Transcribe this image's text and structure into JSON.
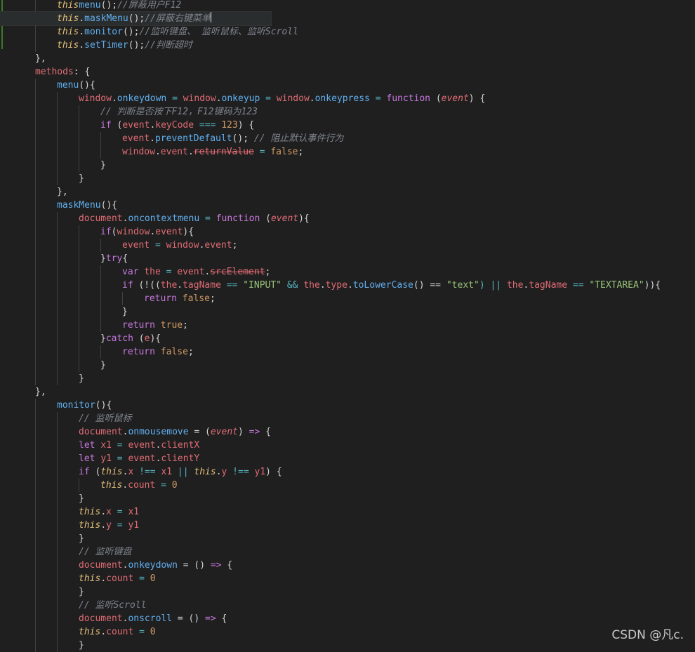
{
  "editor": {
    "lines": [
      {
        "indent": 2,
        "tokens": [
          [
            "this",
            "this"
          ],
          [
            "menu",
            "fn"
          ],
          [
            "();",
            "pun"
          ],
          [
            "//屏蔽用户F12",
            "cm"
          ]
        ]
      },
      {
        "indent": 2,
        "active": true,
        "tokens": [
          [
            "this",
            "this"
          ],
          [
            ".",
            "pun"
          ],
          [
            "maskMenu",
            "fn"
          ],
          [
            "();",
            "pun"
          ],
          [
            "//屏蔽右键菜单",
            "cm"
          ]
        ]
      },
      {
        "indent": 2,
        "tokens": [
          [
            "this",
            "this"
          ],
          [
            ".",
            "pun"
          ],
          [
            "monitor",
            "fn"
          ],
          [
            "();",
            "pun"
          ],
          [
            "//监听键盘、 监听鼠标、监听Scroll",
            "cm"
          ]
        ]
      },
      {
        "indent": 2,
        "tokens": [
          [
            "this",
            "this"
          ],
          [
            ".",
            "pun"
          ],
          [
            "setTimer",
            "fn"
          ],
          [
            "();",
            "pun"
          ],
          [
            "//判断超时",
            "cm"
          ]
        ]
      },
      {
        "indent": 1,
        "tokens": [
          [
            "},",
            "pun"
          ]
        ]
      },
      {
        "indent": 1,
        "tokens": [
          [
            "methods",
            "var"
          ],
          [
            ": {",
            "pun"
          ]
        ]
      },
      {
        "indent": 2,
        "tokens": [
          [
            "menu",
            "fn"
          ],
          [
            "(){",
            "pun"
          ]
        ]
      },
      {
        "indent": 3,
        "tokens": [
          [
            "window",
            "var"
          ],
          [
            ".",
            "pun"
          ],
          [
            "onkeydown",
            "prop"
          ],
          [
            " = ",
            "op"
          ],
          [
            "window",
            "var"
          ],
          [
            ".",
            "pun"
          ],
          [
            "onkeyup",
            "prop"
          ],
          [
            " = ",
            "op"
          ],
          [
            "window",
            "var"
          ],
          [
            ".",
            "pun"
          ],
          [
            "onkeypress",
            "prop"
          ],
          [
            " = ",
            "op"
          ],
          [
            "function",
            "kw"
          ],
          [
            " (",
            "pun"
          ],
          [
            "event",
            "param"
          ],
          [
            ") {",
            "pun"
          ]
        ]
      },
      {
        "indent": 4,
        "tokens": [
          [
            "// 判断是否按下F12，F12键码为123",
            "cm"
          ]
        ]
      },
      {
        "indent": 4,
        "tokens": [
          [
            "if",
            "kw"
          ],
          [
            " (",
            "pun"
          ],
          [
            "event",
            "var"
          ],
          [
            ".",
            "pun"
          ],
          [
            "keyCode",
            "var"
          ],
          [
            " === ",
            "op"
          ],
          [
            "123",
            "num"
          ],
          [
            ") {",
            "pun"
          ]
        ]
      },
      {
        "indent": 5,
        "tokens": [
          [
            "event",
            "var"
          ],
          [
            ".",
            "pun"
          ],
          [
            "preventDefault",
            "fn"
          ],
          [
            "(); ",
            "pun"
          ],
          [
            "// 阻止默认事件行为",
            "cm"
          ]
        ]
      },
      {
        "indent": 5,
        "tokens": [
          [
            "window",
            "var"
          ],
          [
            ".",
            "pun"
          ],
          [
            "event",
            "var"
          ],
          [
            ".",
            "pun"
          ],
          [
            "returnValue",
            "strike"
          ],
          [
            " = ",
            "op"
          ],
          [
            "false",
            "num"
          ],
          [
            ";",
            "pun"
          ]
        ]
      },
      {
        "indent": 4,
        "tokens": [
          [
            "}",
            "pun"
          ]
        ]
      },
      {
        "indent": 3,
        "tokens": [
          [
            "}",
            "pun"
          ]
        ]
      },
      {
        "indent": 2,
        "tokens": [
          [
            "},",
            "pun"
          ]
        ]
      },
      {
        "indent": 2,
        "tokens": [
          [
            "maskMenu",
            "fn"
          ],
          [
            "(){",
            "pun"
          ]
        ]
      },
      {
        "indent": 3,
        "tokens": [
          [
            "document",
            "var"
          ],
          [
            ".",
            "pun"
          ],
          [
            "oncontextmenu",
            "prop"
          ],
          [
            " = ",
            "op"
          ],
          [
            "function",
            "kw"
          ],
          [
            " (",
            "pun"
          ],
          [
            "event",
            "param"
          ],
          [
            "){",
            "pun"
          ]
        ]
      },
      {
        "indent": 4,
        "tokens": [
          [
            "if",
            "kw"
          ],
          [
            "(",
            "pun"
          ],
          [
            "window",
            "var"
          ],
          [
            ".",
            "pun"
          ],
          [
            "event",
            "var"
          ],
          [
            "){",
            "pun"
          ]
        ]
      },
      {
        "indent": 5,
        "tokens": [
          [
            "event",
            "var"
          ],
          [
            " = ",
            "op"
          ],
          [
            "window",
            "var"
          ],
          [
            ".",
            "pun"
          ],
          [
            "event",
            "var"
          ],
          [
            ";",
            "pun"
          ]
        ]
      },
      {
        "indent": 4,
        "tokens": [
          [
            "}",
            "pun"
          ],
          [
            "try",
            "kw"
          ],
          [
            "{",
            "pun"
          ]
        ]
      },
      {
        "indent": 5,
        "tokens": [
          [
            "var",
            "kw"
          ],
          [
            " ",
            "pun"
          ],
          [
            "the",
            "var"
          ],
          [
            " = ",
            "op"
          ],
          [
            "event",
            "var"
          ],
          [
            ".",
            "pun"
          ],
          [
            "srcElement",
            "strike"
          ],
          [
            ";",
            "pun"
          ]
        ]
      },
      {
        "indent": 5,
        "tokens": [
          [
            "if",
            "kw"
          ],
          [
            " (!((",
            "pun"
          ],
          [
            "the",
            "var"
          ],
          [
            ".",
            "pun"
          ],
          [
            "tagName",
            "var"
          ],
          [
            " == ",
            "op"
          ],
          [
            "\"INPUT\"",
            "str"
          ],
          [
            " && ",
            "op"
          ],
          [
            "the",
            "var"
          ],
          [
            ".",
            "pun"
          ],
          [
            "type",
            "var"
          ],
          [
            ".",
            "pun"
          ],
          [
            "toLowerCase",
            "fn"
          ],
          [
            "() == ",
            "pun"
          ],
          [
            "\"text\"",
            "str"
          ],
          [
            ") || ",
            "op"
          ],
          [
            "the",
            "var"
          ],
          [
            ".",
            "pun"
          ],
          [
            "tagName",
            "var"
          ],
          [
            " == ",
            "op"
          ],
          [
            "\"TEXTAREA\"",
            "str"
          ],
          [
            ")){",
            "pun"
          ]
        ]
      },
      {
        "indent": 6,
        "tokens": [
          [
            "return",
            "kw"
          ],
          [
            " ",
            "pun"
          ],
          [
            "false",
            "num"
          ],
          [
            ";",
            "pun"
          ]
        ]
      },
      {
        "indent": 5,
        "tokens": [
          [
            "}",
            "pun"
          ]
        ]
      },
      {
        "indent": 5,
        "tokens": [
          [
            "return",
            "kw"
          ],
          [
            " ",
            "pun"
          ],
          [
            "true",
            "num"
          ],
          [
            ";",
            "pun"
          ]
        ]
      },
      {
        "indent": 4,
        "tokens": [
          [
            "}",
            "pun"
          ],
          [
            "catch",
            "kw"
          ],
          [
            " (",
            "pun"
          ],
          [
            "e",
            "var"
          ],
          [
            "){",
            "pun"
          ]
        ]
      },
      {
        "indent": 5,
        "tokens": [
          [
            "return",
            "kw"
          ],
          [
            " ",
            "pun"
          ],
          [
            "false",
            "num"
          ],
          [
            ";",
            "pun"
          ]
        ]
      },
      {
        "indent": 4,
        "tokens": [
          [
            "}",
            "pun"
          ]
        ]
      },
      {
        "indent": 3,
        "tokens": [
          [
            "}",
            "pun"
          ]
        ]
      },
      {
        "indent": 1,
        "tokens": [
          [
            "},",
            "pun"
          ]
        ]
      },
      {
        "indent": 2,
        "tokens": [
          [
            "monitor",
            "fn"
          ],
          [
            "(){",
            "pun"
          ]
        ]
      },
      {
        "indent": 3,
        "tokens": [
          [
            "// 监听鼠标",
            "cm"
          ]
        ]
      },
      {
        "indent": 3,
        "tokens": [
          [
            "document",
            "var"
          ],
          [
            ".",
            "pun"
          ],
          [
            "onmousemove",
            "prop"
          ],
          [
            " = (",
            "pun"
          ],
          [
            "event",
            "param"
          ],
          [
            ") ",
            "pun"
          ],
          [
            "=>",
            "kw"
          ],
          [
            " {",
            "pun"
          ]
        ]
      },
      {
        "indent": 3,
        "tokens": [
          [
            "let",
            "kw"
          ],
          [
            " ",
            "pun"
          ],
          [
            "x1",
            "var"
          ],
          [
            " = ",
            "op"
          ],
          [
            "event",
            "var"
          ],
          [
            ".",
            "pun"
          ],
          [
            "clientX",
            "var"
          ]
        ]
      },
      {
        "indent": 3,
        "tokens": [
          [
            "let",
            "kw"
          ],
          [
            " ",
            "pun"
          ],
          [
            "y1",
            "var"
          ],
          [
            " = ",
            "op"
          ],
          [
            "event",
            "var"
          ],
          [
            ".",
            "pun"
          ],
          [
            "clientY",
            "var"
          ]
        ]
      },
      {
        "indent": 3,
        "tokens": [
          [
            "if",
            "kw"
          ],
          [
            " (",
            "pun"
          ],
          [
            "this",
            "this"
          ],
          [
            ".",
            "pun"
          ],
          [
            "x",
            "var"
          ],
          [
            " !== ",
            "op"
          ],
          [
            "x1",
            "var"
          ],
          [
            " || ",
            "op"
          ],
          [
            "this",
            "this"
          ],
          [
            ".",
            "pun"
          ],
          [
            "y",
            "var"
          ],
          [
            " !== ",
            "op"
          ],
          [
            "y1",
            "var"
          ],
          [
            ") {",
            "pun"
          ]
        ]
      },
      {
        "indent": 4,
        "tokens": [
          [
            "this",
            "this"
          ],
          [
            ".",
            "pun"
          ],
          [
            "count",
            "var"
          ],
          [
            " = ",
            "op"
          ],
          [
            "0",
            "num"
          ]
        ]
      },
      {
        "indent": 3,
        "tokens": [
          [
            "}",
            "pun"
          ]
        ]
      },
      {
        "indent": 3,
        "tokens": [
          [
            "this",
            "this"
          ],
          [
            ".",
            "pun"
          ],
          [
            "x",
            "var"
          ],
          [
            " = ",
            "op"
          ],
          [
            "x1",
            "var"
          ]
        ]
      },
      {
        "indent": 3,
        "tokens": [
          [
            "this",
            "this"
          ],
          [
            ".",
            "pun"
          ],
          [
            "y",
            "var"
          ],
          [
            " = ",
            "op"
          ],
          [
            "y1",
            "var"
          ]
        ]
      },
      {
        "indent": 3,
        "tokens": [
          [
            "}",
            "pun"
          ]
        ]
      },
      {
        "indent": 3,
        "tokens": [
          [
            "// 监听键盘",
            "cm"
          ]
        ]
      },
      {
        "indent": 3,
        "tokens": [
          [
            "document",
            "var"
          ],
          [
            ".",
            "pun"
          ],
          [
            "onkeydown",
            "prop"
          ],
          [
            " = () ",
            "pun"
          ],
          [
            "=>",
            "kw"
          ],
          [
            " {",
            "pun"
          ]
        ]
      },
      {
        "indent": 3,
        "tokens": [
          [
            "this",
            "this"
          ],
          [
            ".",
            "pun"
          ],
          [
            "count",
            "var"
          ],
          [
            " = ",
            "op"
          ],
          [
            "0",
            "num"
          ]
        ]
      },
      {
        "indent": 3,
        "tokens": [
          [
            "}",
            "pun"
          ]
        ]
      },
      {
        "indent": 3,
        "tokens": [
          [
            "// 监听Scroll",
            "cm"
          ]
        ]
      },
      {
        "indent": 3,
        "tokens": [
          [
            "document",
            "var"
          ],
          [
            ".",
            "pun"
          ],
          [
            "onscroll",
            "prop"
          ],
          [
            " = () ",
            "pun"
          ],
          [
            "=>",
            "kw"
          ],
          [
            " {",
            "pun"
          ]
        ]
      },
      {
        "indent": 3,
        "tokens": [
          [
            "this",
            "this"
          ],
          [
            ".",
            "pun"
          ],
          [
            "count",
            "var"
          ],
          [
            " = ",
            "op"
          ],
          [
            "0",
            "num"
          ]
        ]
      },
      {
        "indent": 3,
        "tokens": [
          [
            "}",
            "pun"
          ]
        ]
      }
    ]
  },
  "watermark": "CSDN @凡c."
}
